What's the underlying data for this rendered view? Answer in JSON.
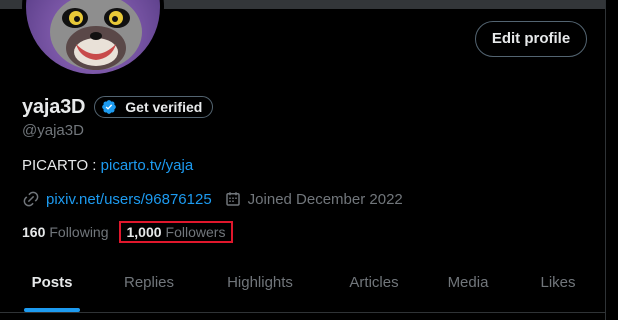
{
  "profile": {
    "display_name": "yaja3D",
    "verify_label": "Get verified",
    "handle": "@yaja3D",
    "bio_prefix": "PICARTO : ",
    "bio_link": "picarto.tv/yaja",
    "website": "pixiv.net/users/96876125",
    "joined": "Joined December 2022",
    "edit_label": "Edit profile"
  },
  "stats": {
    "following_count": "160",
    "following_label": "Following",
    "followers_count": "1,000",
    "followers_label": "Followers"
  },
  "tabs": [
    {
      "label": "Posts",
      "active": true
    },
    {
      "label": "Replies",
      "active": false
    },
    {
      "label": "Highlights",
      "active": false
    },
    {
      "label": "Articles",
      "active": false
    },
    {
      "label": "Media",
      "active": false
    },
    {
      "label": "Likes",
      "active": false
    }
  ],
  "colors": {
    "background": "#000000",
    "text_primary": "#e7e9ea",
    "text_secondary": "#71767b",
    "accent": "#1d9bf0",
    "highlight_box": "#e0172c",
    "border": "#536471"
  },
  "icons": {
    "verified": "verified-badge-icon",
    "link": "link-icon",
    "calendar": "calendar-icon"
  }
}
